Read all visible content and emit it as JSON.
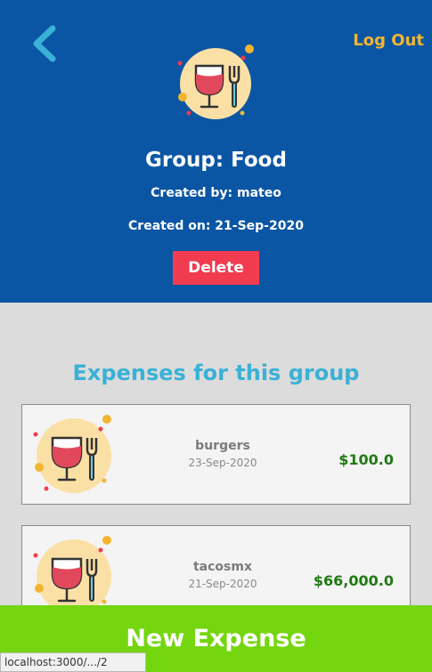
{
  "header": {
    "back_icon": "chevron-left-icon",
    "logout_label": "Log Out",
    "group_icon": "wine-fork-icon",
    "title": "Group: Food",
    "created_by": "Created by: mateo",
    "created_on": "Created on: 21-Sep-2020",
    "delete_label": "Delete"
  },
  "section": {
    "title": "Expenses for this group"
  },
  "expenses": [
    {
      "icon": "wine-fork-icon",
      "name": "burgers",
      "date": "23-Sep-2020",
      "amount": "$100.0"
    },
    {
      "icon": "wine-fork-icon",
      "name": "tacosmx",
      "date": "21-Sep-2020",
      "amount": "$66,000.0"
    }
  ],
  "footer": {
    "new_expense_label": "New Expense"
  },
  "status": {
    "url": "localhost:3000/.../2"
  },
  "colors": {
    "header_bg": "#0b56a4",
    "accent_yellow": "#f2b531",
    "delete_red": "#f13b4f",
    "title_cyan": "#3ab1d6",
    "amount_green": "#1f7a12",
    "new_expense_green": "#74d60f"
  }
}
